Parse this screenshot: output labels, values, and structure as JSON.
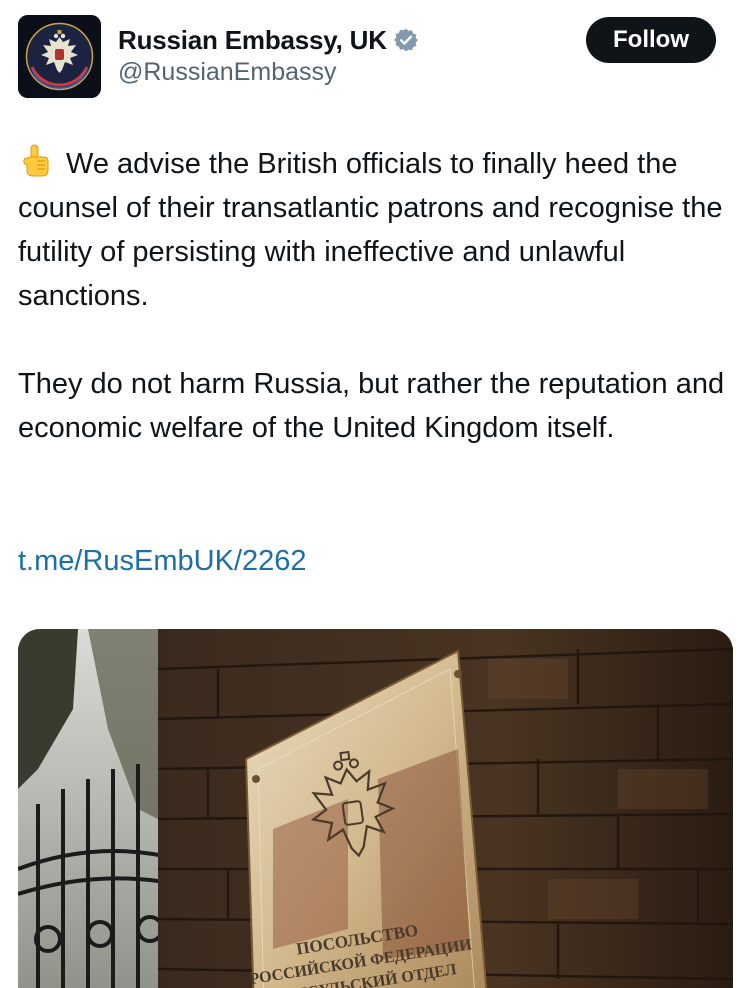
{
  "author": {
    "display_name": "Russian Embassy, UK",
    "handle": "@RussianEmbassy",
    "verified": true,
    "avatar_icon": "embassy-eagle-emblem-icon"
  },
  "follow_button": {
    "label": "Follow"
  },
  "tweet": {
    "emoji_icon": "pointing-up-hand-icon",
    "paragraph_1": "We advise the British officials to finally heed the counsel of their transatlantic patrons and recognise the futility of persisting with ineffective and unlawful sanctions.",
    "paragraph_2": "They do not harm Russia, but rather the reputation and economic welfare of the United Kingdom itself.",
    "link_text": "t.me/RusEmbUK/2262"
  },
  "media": {
    "plaque_line_1": "ПОСОЛЬСТВО",
    "plaque_line_2": "РОССИЙСКОЙ ФЕДЕРАЦИИ",
    "plaque_line_3": "КОНСУЛЬСКИЙ ОТДЕЛ"
  },
  "colors": {
    "text_primary": "#0f1419",
    "text_secondary": "#536471",
    "link": "#1d6fa5",
    "follow_bg": "#0f1419",
    "verified_badge": "#829aab"
  }
}
